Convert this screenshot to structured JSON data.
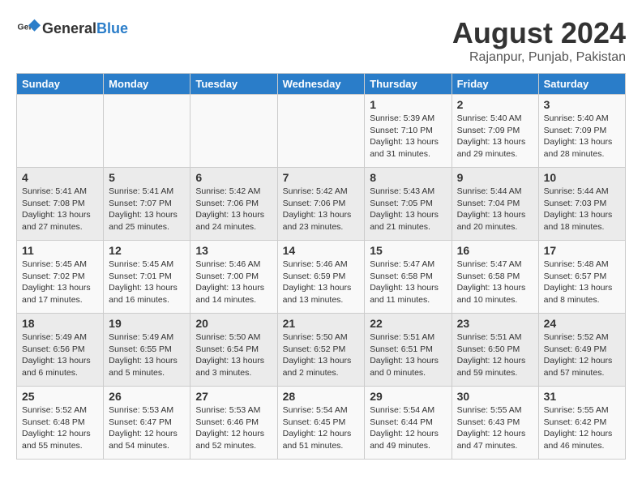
{
  "header": {
    "logo_general": "General",
    "logo_blue": "Blue",
    "month": "August 2024",
    "location": "Rajanpur, Punjab, Pakistan"
  },
  "weekdays": [
    "Sunday",
    "Monday",
    "Tuesday",
    "Wednesday",
    "Thursday",
    "Friday",
    "Saturday"
  ],
  "weeks": [
    [
      {
        "day": "",
        "info": ""
      },
      {
        "day": "",
        "info": ""
      },
      {
        "day": "",
        "info": ""
      },
      {
        "day": "",
        "info": ""
      },
      {
        "day": "1",
        "info": "Sunrise: 5:39 AM\nSunset: 7:10 PM\nDaylight: 13 hours\nand 31 minutes."
      },
      {
        "day": "2",
        "info": "Sunrise: 5:40 AM\nSunset: 7:09 PM\nDaylight: 13 hours\nand 29 minutes."
      },
      {
        "day": "3",
        "info": "Sunrise: 5:40 AM\nSunset: 7:09 PM\nDaylight: 13 hours\nand 28 minutes."
      }
    ],
    [
      {
        "day": "4",
        "info": "Sunrise: 5:41 AM\nSunset: 7:08 PM\nDaylight: 13 hours\nand 27 minutes."
      },
      {
        "day": "5",
        "info": "Sunrise: 5:41 AM\nSunset: 7:07 PM\nDaylight: 13 hours\nand 25 minutes."
      },
      {
        "day": "6",
        "info": "Sunrise: 5:42 AM\nSunset: 7:06 PM\nDaylight: 13 hours\nand 24 minutes."
      },
      {
        "day": "7",
        "info": "Sunrise: 5:42 AM\nSunset: 7:06 PM\nDaylight: 13 hours\nand 23 minutes."
      },
      {
        "day": "8",
        "info": "Sunrise: 5:43 AM\nSunset: 7:05 PM\nDaylight: 13 hours\nand 21 minutes."
      },
      {
        "day": "9",
        "info": "Sunrise: 5:44 AM\nSunset: 7:04 PM\nDaylight: 13 hours\nand 20 minutes."
      },
      {
        "day": "10",
        "info": "Sunrise: 5:44 AM\nSunset: 7:03 PM\nDaylight: 13 hours\nand 18 minutes."
      }
    ],
    [
      {
        "day": "11",
        "info": "Sunrise: 5:45 AM\nSunset: 7:02 PM\nDaylight: 13 hours\nand 17 minutes."
      },
      {
        "day": "12",
        "info": "Sunrise: 5:45 AM\nSunset: 7:01 PM\nDaylight: 13 hours\nand 16 minutes."
      },
      {
        "day": "13",
        "info": "Sunrise: 5:46 AM\nSunset: 7:00 PM\nDaylight: 13 hours\nand 14 minutes."
      },
      {
        "day": "14",
        "info": "Sunrise: 5:46 AM\nSunset: 6:59 PM\nDaylight: 13 hours\nand 13 minutes."
      },
      {
        "day": "15",
        "info": "Sunrise: 5:47 AM\nSunset: 6:58 PM\nDaylight: 13 hours\nand 11 minutes."
      },
      {
        "day": "16",
        "info": "Sunrise: 5:47 AM\nSunset: 6:58 PM\nDaylight: 13 hours\nand 10 minutes."
      },
      {
        "day": "17",
        "info": "Sunrise: 5:48 AM\nSunset: 6:57 PM\nDaylight: 13 hours\nand 8 minutes."
      }
    ],
    [
      {
        "day": "18",
        "info": "Sunrise: 5:49 AM\nSunset: 6:56 PM\nDaylight: 13 hours\nand 6 minutes."
      },
      {
        "day": "19",
        "info": "Sunrise: 5:49 AM\nSunset: 6:55 PM\nDaylight: 13 hours\nand 5 minutes."
      },
      {
        "day": "20",
        "info": "Sunrise: 5:50 AM\nSunset: 6:54 PM\nDaylight: 13 hours\nand 3 minutes."
      },
      {
        "day": "21",
        "info": "Sunrise: 5:50 AM\nSunset: 6:52 PM\nDaylight: 13 hours\nand 2 minutes."
      },
      {
        "day": "22",
        "info": "Sunrise: 5:51 AM\nSunset: 6:51 PM\nDaylight: 13 hours\nand 0 minutes."
      },
      {
        "day": "23",
        "info": "Sunrise: 5:51 AM\nSunset: 6:50 PM\nDaylight: 12 hours\nand 59 minutes."
      },
      {
        "day": "24",
        "info": "Sunrise: 5:52 AM\nSunset: 6:49 PM\nDaylight: 12 hours\nand 57 minutes."
      }
    ],
    [
      {
        "day": "25",
        "info": "Sunrise: 5:52 AM\nSunset: 6:48 PM\nDaylight: 12 hours\nand 55 minutes."
      },
      {
        "day": "26",
        "info": "Sunrise: 5:53 AM\nSunset: 6:47 PM\nDaylight: 12 hours\nand 54 minutes."
      },
      {
        "day": "27",
        "info": "Sunrise: 5:53 AM\nSunset: 6:46 PM\nDaylight: 12 hours\nand 52 minutes."
      },
      {
        "day": "28",
        "info": "Sunrise: 5:54 AM\nSunset: 6:45 PM\nDaylight: 12 hours\nand 51 minutes."
      },
      {
        "day": "29",
        "info": "Sunrise: 5:54 AM\nSunset: 6:44 PM\nDaylight: 12 hours\nand 49 minutes."
      },
      {
        "day": "30",
        "info": "Sunrise: 5:55 AM\nSunset: 6:43 PM\nDaylight: 12 hours\nand 47 minutes."
      },
      {
        "day": "31",
        "info": "Sunrise: 5:55 AM\nSunset: 6:42 PM\nDaylight: 12 hours\nand 46 minutes."
      }
    ]
  ]
}
